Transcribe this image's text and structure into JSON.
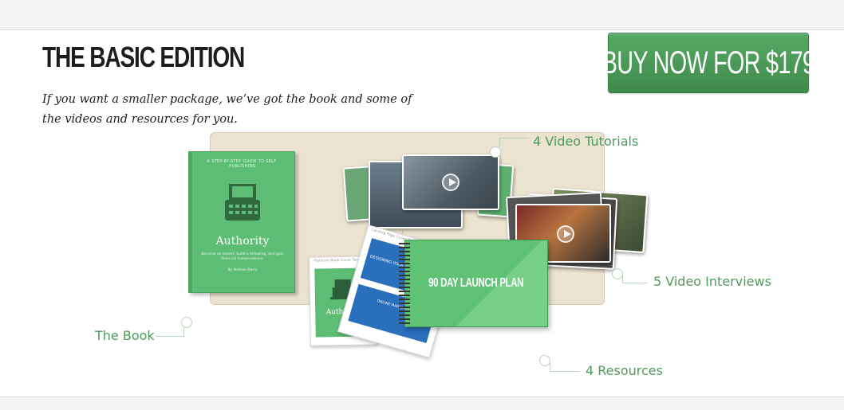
{
  "header": {
    "title": "THE BASIC EDITION",
    "subtitle": "If you want a smaller package, we’ve got the book and some of the videos and resources for you."
  },
  "cta": {
    "label": "BUY NOW FOR $179"
  },
  "package": {
    "labels": {
      "video_tutorials": "4 Video Tutorials",
      "video_interviews": "5 Video Interviews",
      "book": "The Book",
      "resources": "4 Resources"
    },
    "book": {
      "tagline": "A STEP-BY-STEP GUIDE TO SELF-PUBLISHING",
      "title": "Authority",
      "subtitle": "Become an expert, build a following, and gain financial independence.",
      "author": "By Nathan Barry"
    },
    "mini_book_title": "Authority",
    "resources": {
      "sheet1_caption": "Platinum Book Cover Template",
      "sheet2_caption": "Landing Page Cover Template",
      "sheet2_heading": "DESIGNING YOUR BOOK COVER",
      "sheet3_label": "ONLINE MARKETING",
      "launch_plan": "90 DAY LAUNCH PLAN"
    }
  },
  "colors": {
    "accent_green": "#4e9b5c",
    "button_green": "#4e9d5a",
    "folder": "#ece3d0"
  }
}
